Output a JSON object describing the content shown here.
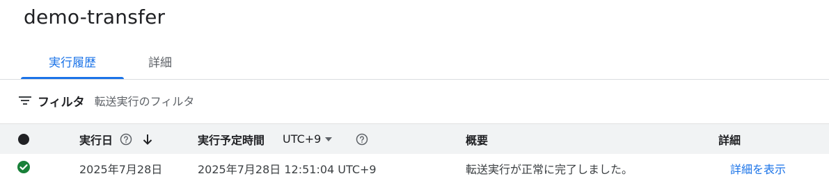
{
  "page": {
    "title": "demo-transfer"
  },
  "tabs": [
    {
      "label": "実行履歴",
      "active": true
    },
    {
      "label": "詳細",
      "active": false
    }
  ],
  "filter": {
    "label": "フィルタ",
    "placeholder": "転送実行のフィルタ",
    "icon": "filter-list-icon"
  },
  "table": {
    "columns": {
      "status_icon": "status-dot-icon",
      "run_date": "実行日",
      "scheduled_time": "実行予定時間",
      "timezone": "UTC+9",
      "summary": "概要",
      "details": "詳細"
    },
    "sort_icon": "arrow-down-icon",
    "help_icon": "help-circle-icon",
    "rows": [
      {
        "status": "success",
        "status_icon": "check-circle-icon",
        "run_date": "2025年7月28日",
        "scheduled_time": "2025年7月28日 12:51:04 UTC+9",
        "summary": "転送実行が正常に完了しました。",
        "details_link": "詳細を表示"
      }
    ]
  },
  "colors": {
    "accent": "#1a73e8",
    "success": "#188038",
    "header_bg": "#f1f3f4",
    "divider": "#dadce0"
  }
}
